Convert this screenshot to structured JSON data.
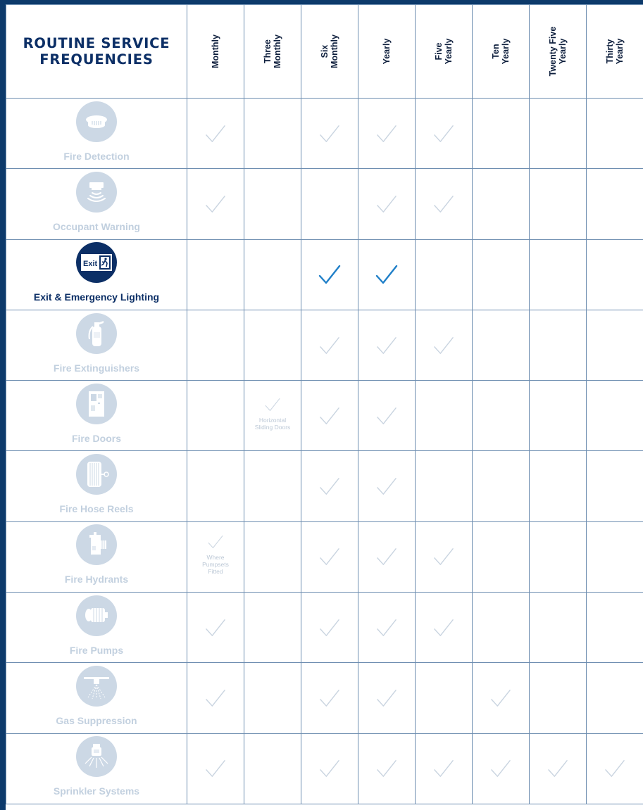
{
  "title": "ROUTINE SERVICE\nFREQUENCIES",
  "columns": [
    "Monthly",
    "Three\nMonthly",
    "Six\nMonthly",
    "Yearly",
    "Five\nYearly",
    "Ten\nYearly",
    "Twenty Five\nYearly",
    "Thirty\nYearly"
  ],
  "colors": {
    "navy": "#0c2f66",
    "border": "#6d8db0",
    "check_faded": "#c9d4e0",
    "check_active": "#1f7fc8",
    "icon_faded": "#ccd8e5"
  },
  "rows": [
    {
      "name": "Fire Detection",
      "icon": "smoke-detector-icon",
      "active": false,
      "checks": [
        true,
        false,
        true,
        true,
        true,
        false,
        false,
        false
      ]
    },
    {
      "name": "Occupant Warning",
      "icon": "warning-speaker-icon",
      "active": false,
      "checks": [
        true,
        false,
        false,
        true,
        true,
        false,
        false,
        false
      ]
    },
    {
      "name": "Exit & Emergency Lighting",
      "icon": "exit-sign-icon",
      "active": true,
      "exit_text": "Exit",
      "checks": [
        false,
        false,
        true,
        true,
        false,
        false,
        false,
        false
      ]
    },
    {
      "name": "Fire Extinguishers",
      "icon": "extinguisher-icon",
      "active": false,
      "checks": [
        false,
        false,
        true,
        true,
        true,
        false,
        false,
        false
      ]
    },
    {
      "name": "Fire Doors",
      "icon": "fire-door-icon",
      "active": false,
      "checks": [
        false,
        true,
        true,
        true,
        false,
        false,
        false,
        false
      ],
      "notes": {
        "1": "Horizontal\nSliding Doors"
      }
    },
    {
      "name": "Fire Hose Reels",
      "icon": "hose-reel-icon",
      "active": false,
      "checks": [
        false,
        false,
        true,
        true,
        false,
        false,
        false,
        false
      ]
    },
    {
      "name": "Fire Hydrants",
      "icon": "hydrant-icon",
      "active": false,
      "checks": [
        true,
        false,
        true,
        true,
        true,
        false,
        false,
        false
      ],
      "notes": {
        "0": "Where\nPumpsets\nFitted"
      }
    },
    {
      "name": "Fire Pumps",
      "icon": "pump-icon",
      "active": false,
      "checks": [
        true,
        false,
        true,
        true,
        true,
        false,
        false,
        false
      ]
    },
    {
      "name": "Gas Suppression",
      "icon": "gas-nozzle-icon",
      "active": false,
      "checks": [
        true,
        false,
        true,
        true,
        false,
        true,
        false,
        false
      ]
    },
    {
      "name": "Sprinkler Systems",
      "icon": "sprinkler-icon",
      "active": false,
      "checks": [
        true,
        false,
        true,
        true,
        true,
        true,
        true,
        true
      ]
    }
  ]
}
